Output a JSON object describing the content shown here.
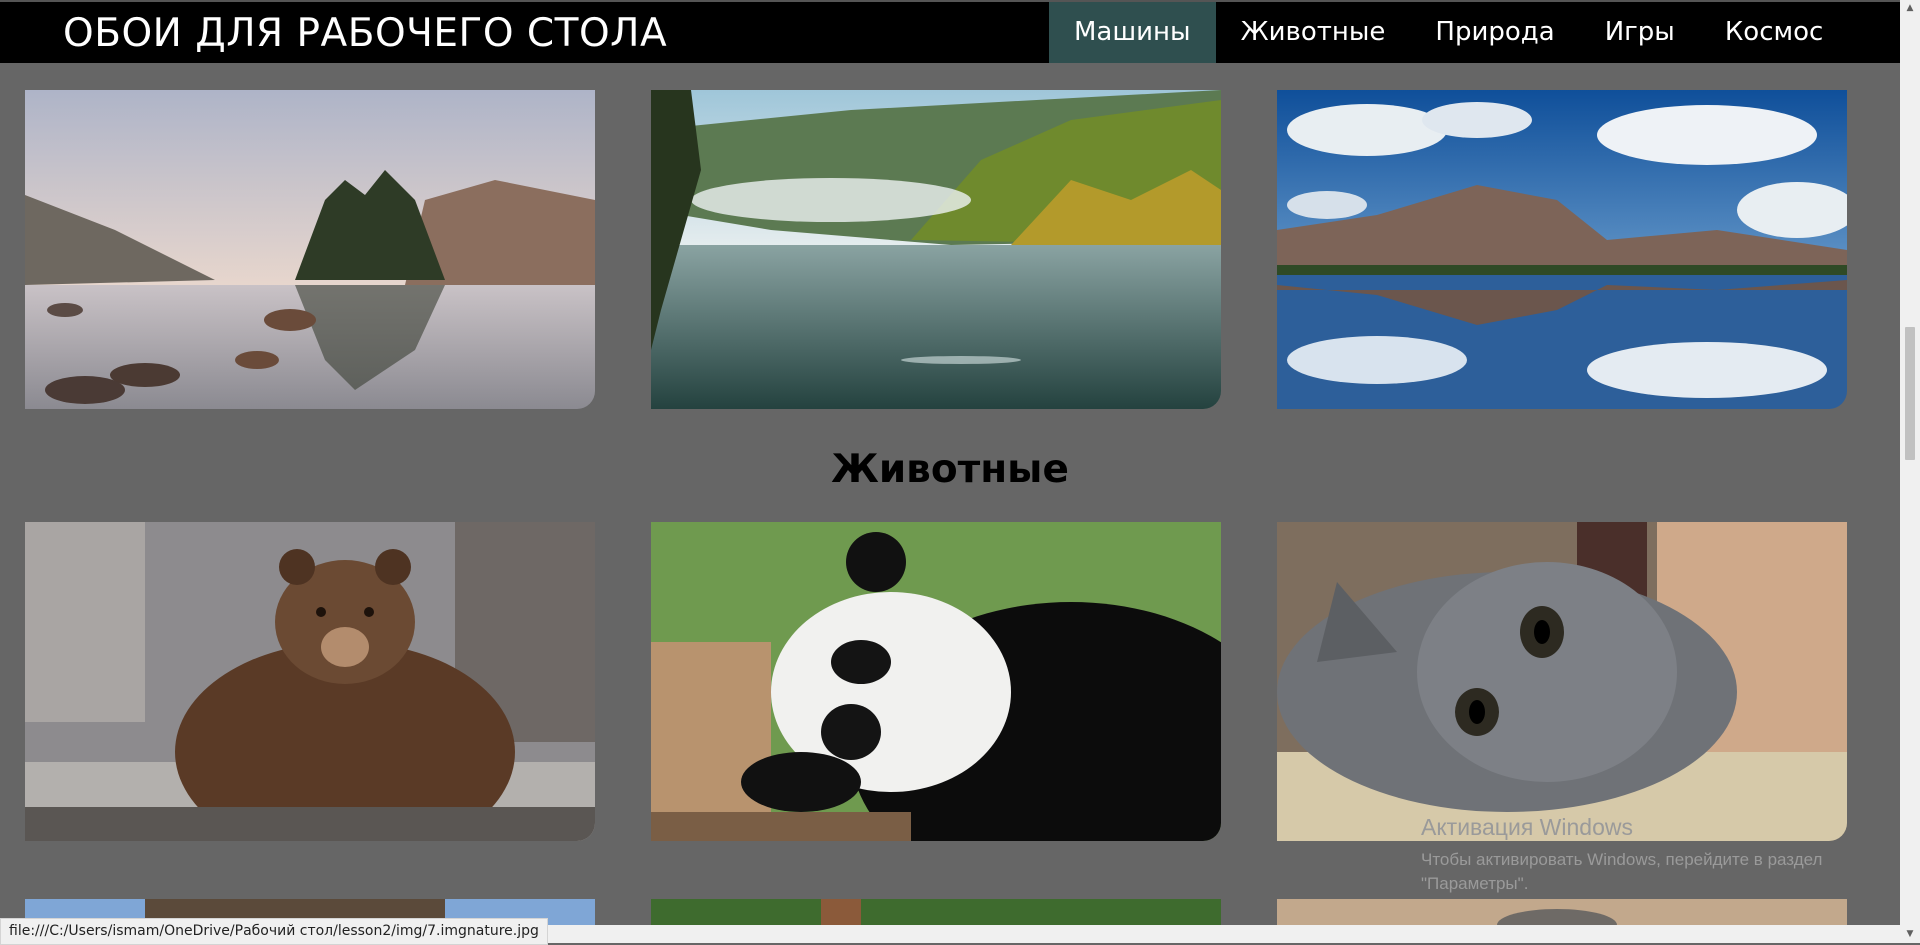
{
  "header": {
    "site_title": "ОБОИ ДЛЯ РАБОЧЕГО СТОЛА",
    "nav": [
      {
        "label": "Машины",
        "active": true
      },
      {
        "label": "Животные",
        "active": false
      },
      {
        "label": "Природа",
        "active": false
      },
      {
        "label": "Игры",
        "active": false
      },
      {
        "label": "Космос",
        "active": false
      }
    ]
  },
  "sections": [
    {
      "heading": "Животные"
    }
  ],
  "status_bar": {
    "url": "file:///C:/Users/ismam/OneDrive/Рабочий стол/lesson2/img/7.imgnature.jpg"
  },
  "watermark": {
    "title": "Активация Windows",
    "subtitle": "Чтобы активировать Windows, перейдите в раздел \"Параметры\"."
  },
  "colors": {
    "page_bg": "#666666",
    "header_bg": "#000000",
    "nav_active_bg": "#2f4f4f"
  }
}
